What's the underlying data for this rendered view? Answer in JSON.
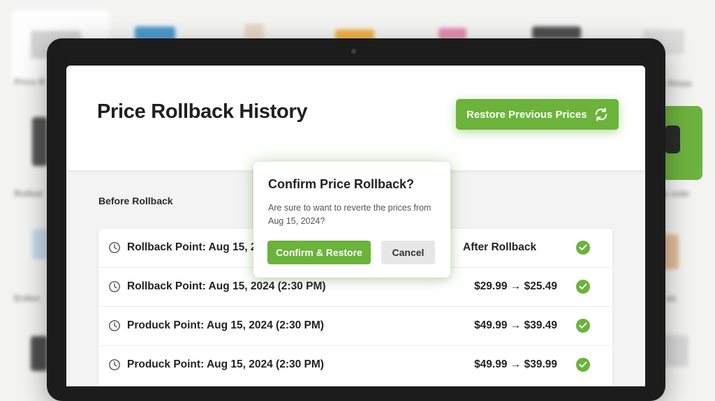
{
  "page": {
    "title": "Price Rollback History",
    "restore_button": "Restore Previous Prices",
    "section_label": "Before Rollback"
  },
  "table": {
    "after_header": "After Rollback",
    "rows": [
      {
        "name": "Rollback Point: Aug 15, 2024 (2:30 PM)",
        "price": ""
      },
      {
        "name": "Rollback Point: Aug 15, 2024 (2:30 PM)",
        "price": "$29.99 → $25.49"
      },
      {
        "name": "Produck Point: Aug 15, 2024 (2:30 PM)",
        "price": "$49.99 → $39.49"
      },
      {
        "name": "Produck Point: Aug 15, 2024 (2:30 PM)",
        "price": "$49.99 → $39.99"
      }
    ]
  },
  "modal": {
    "title": "Confirm Price Rollback?",
    "message": "Are sure to want to reverte the prices from Aug 15, 2024?",
    "confirm_button": "Confirm & Restore",
    "cancel_button": "Cancel"
  },
  "background": {
    "labels": [
      "Price R",
      "Rolbut",
      "Erden",
      "r fimas",
      "e sole",
      "as"
    ]
  },
  "colors": {
    "accent": "#6bb33a",
    "frame": "#1c1c1c",
    "screen_bg": "#f2f3f2"
  },
  "icons": [
    "refresh-icon",
    "clock-icon",
    "check-circle-icon"
  ]
}
